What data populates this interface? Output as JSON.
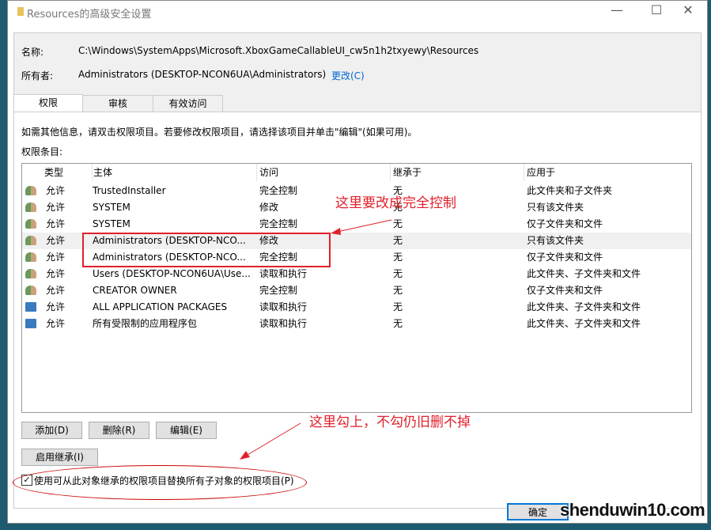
{
  "window": {
    "title": "Resources的高级安全设置",
    "minimize": "—",
    "maximize": "☐",
    "close": "✕"
  },
  "name_label": "名称:",
  "name_value": "C:\\Windows\\SystemApps\\Microsoft.XboxGameCallableUI_cw5n1h2txyewy\\Resources",
  "owner_label": "所有者:",
  "owner_value": "Administrators (DESKTOP-NCON6UA\\Administrators)",
  "change_link": "更改(C)",
  "tabs": [
    {
      "label": "权限",
      "active": true
    },
    {
      "label": "审核"
    },
    {
      "label": "有效访问"
    }
  ],
  "info": "如需其他信息，请双击权限项目。若要修改权限项目，请选择该项目并单击\"编辑\"(如果可用)。",
  "entries_label": "权限条目:",
  "columns": [
    "类型",
    "主体",
    "访问",
    "继承于",
    "应用于"
  ],
  "rows": [
    {
      "icon": "users-icon",
      "type": "允许",
      "principal": "TrustedInstaller",
      "access": "完全控制",
      "inherit": "无",
      "apply": "此文件夹和子文件夹"
    },
    {
      "icon": "users-icon",
      "type": "允许",
      "principal": "SYSTEM",
      "access": "修改",
      "inherit": "无",
      "apply": "只有该文件夹"
    },
    {
      "icon": "users-icon",
      "type": "允许",
      "principal": "SYSTEM",
      "access": "完全控制",
      "inherit": "无",
      "apply": "仅子文件夹和文件"
    },
    {
      "icon": "users-icon",
      "type": "允许",
      "principal": "Administrators (DESKTOP-NCO...",
      "access": "修改",
      "inherit": "无",
      "apply": "只有该文件夹",
      "selected": true
    },
    {
      "icon": "users-icon",
      "type": "允许",
      "principal": "Administrators (DESKTOP-NCO...",
      "access": "完全控制",
      "inherit": "无",
      "apply": "仅子文件夹和文件"
    },
    {
      "icon": "users-icon",
      "type": "允许",
      "principal": "Users (DESKTOP-NCON6UA\\Use...",
      "access": "读取和执行",
      "inherit": "无",
      "apply": "此文件夹、子文件夹和文件"
    },
    {
      "icon": "users-icon",
      "type": "允许",
      "principal": "CREATOR OWNER",
      "access": "完全控制",
      "inherit": "无",
      "apply": "仅子文件夹和文件"
    },
    {
      "icon": "package-icon",
      "type": "允许",
      "principal": "ALL APPLICATION PACKAGES",
      "access": "读取和执行",
      "inherit": "无",
      "apply": "此文件夹、子文件夹和文件"
    },
    {
      "icon": "package-icon",
      "type": "允许",
      "principal": "所有受限制的应用程序包",
      "access": "读取和执行",
      "inherit": "无",
      "apply": "此文件夹、子文件夹和文件"
    }
  ],
  "buttons": {
    "add": "添加(D)",
    "remove": "删除(R)",
    "edit": "编辑(E)",
    "enable_inherit": "启用继承(I)",
    "ok": "确定"
  },
  "replace_checkbox": {
    "label": "使用可从此对象继承的权限项目替换所有子对象的权限项目(P)",
    "checked": true
  },
  "annotations": {
    "a1": "这里要改成完全控制",
    "a2": "这里勾上，不勾仍旧删不掉"
  },
  "watermark": "shenduwin10.com",
  "colors": {
    "annotation": "#e0202a",
    "link": "#0066cc"
  }
}
